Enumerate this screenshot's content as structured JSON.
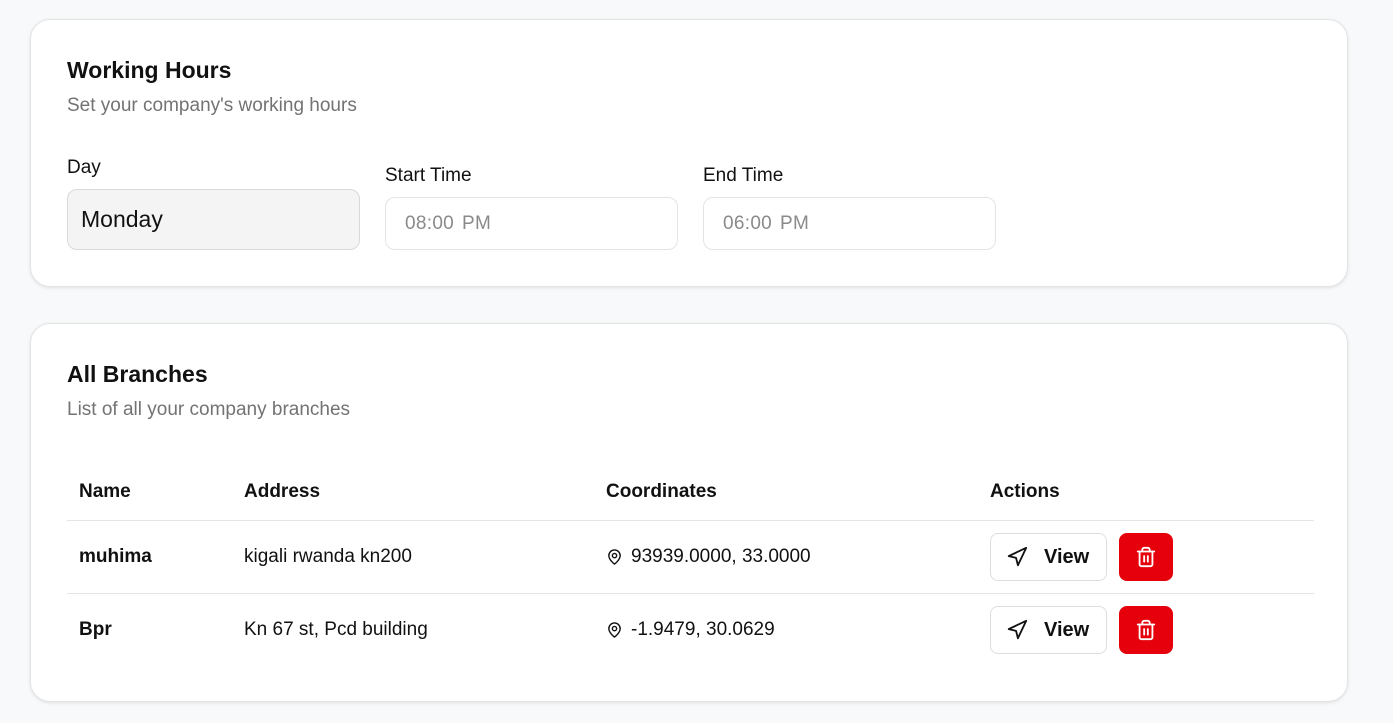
{
  "working_hours": {
    "title": "Working Hours",
    "subtitle": "Set your company's working hours",
    "day_label": "Day",
    "day_value": "Monday",
    "start_label": "Start Time",
    "start_time": "08:00",
    "start_period": "PM",
    "end_label": "End Time",
    "end_time": "06:00",
    "end_period": "PM"
  },
  "branches": {
    "title": "All Branches",
    "subtitle": "List of all your company branches",
    "columns": [
      "Name",
      "Address",
      "Coordinates",
      "Actions"
    ],
    "rows": [
      {
        "name": "muhima",
        "address": "kigali rwanda kn200",
        "coordinates": "93939.0000, 33.0000",
        "view_label": "View"
      },
      {
        "name": "Bpr",
        "address": "Kn 67 st, Pcd building",
        "coordinates": "-1.9479, 30.0629",
        "view_label": "View"
      }
    ]
  },
  "icons": {
    "location": "map-pin-icon",
    "view": "navigation-arrow-icon",
    "delete": "trash-icon"
  },
  "colors": {
    "delete_button": "#e5000b",
    "muted_text": "#737373"
  }
}
